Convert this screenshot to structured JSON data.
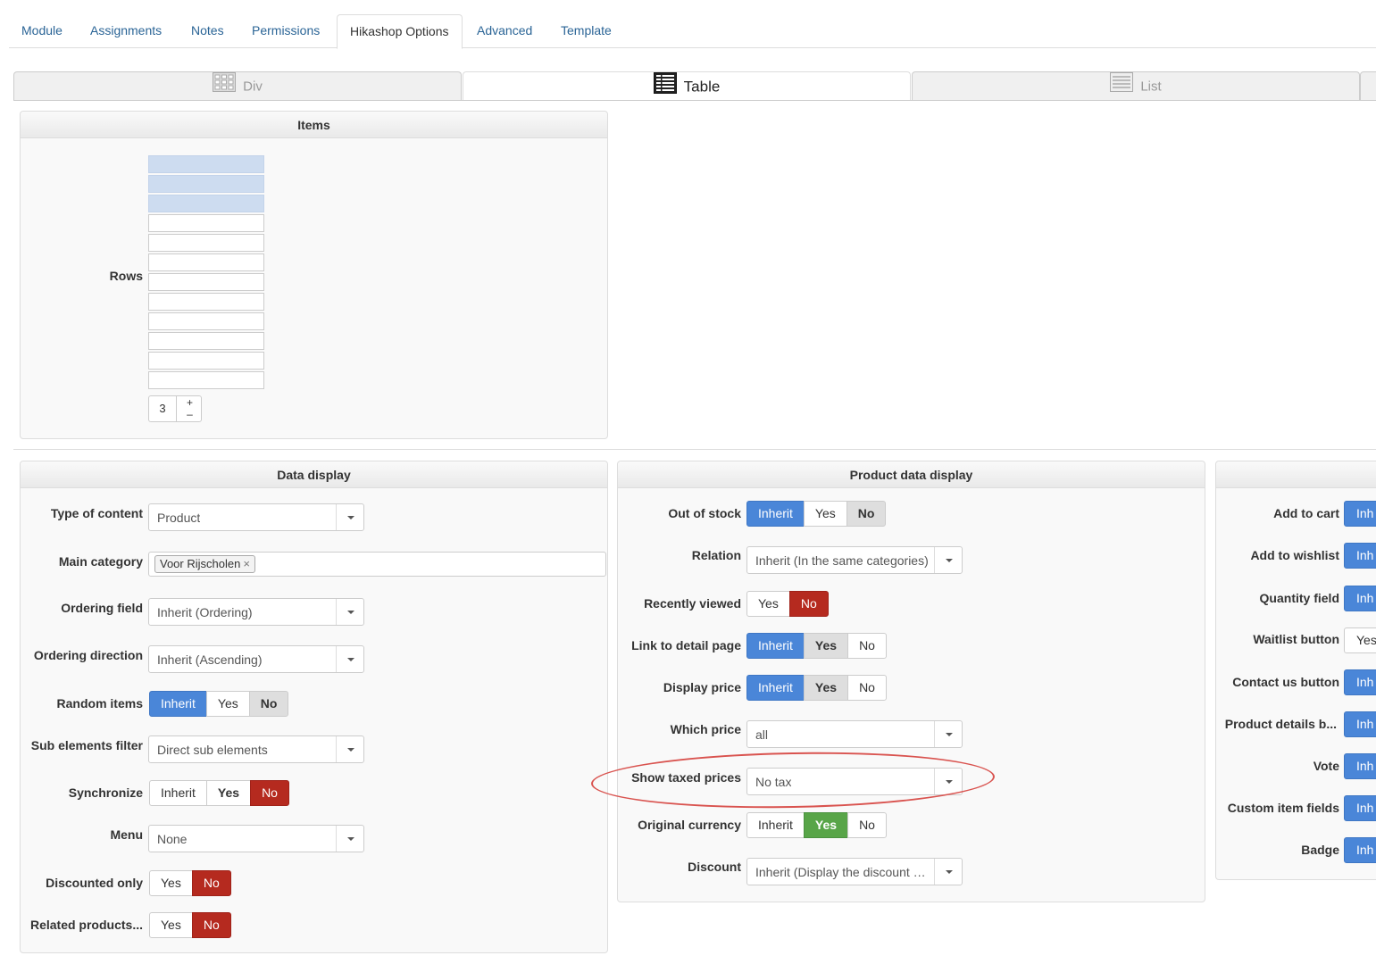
{
  "nav_tabs": [
    "Module",
    "Assignments",
    "Notes",
    "Permissions",
    "Hikashop Options",
    "Advanced",
    "Template"
  ],
  "layout_tabs": [
    "Div",
    "Table",
    "List"
  ],
  "items_panel": {
    "title": "Items",
    "rows_label": "Rows",
    "rows_value": "3",
    "plus": "+",
    "minus": "–"
  },
  "data_display": {
    "title": "Data display",
    "type_of_content": {
      "label": "Type of content",
      "value": "Product"
    },
    "main_category": {
      "label": "Main category",
      "tag": "Voor Rijscholen",
      "remove": "×"
    },
    "ordering_field": {
      "label": "Ordering field",
      "value": "Inherit (Ordering)"
    },
    "ordering_direction": {
      "label": "Ordering direction",
      "value": "Inherit (Ascending)"
    },
    "random_items": {
      "label": "Random items",
      "options": [
        "Inherit",
        "Yes",
        "No"
      ]
    },
    "sub_elements_filter": {
      "label": "Sub elements filter",
      "value": "Direct sub elements"
    },
    "synchronize": {
      "label": "Synchronize",
      "options": [
        "Inherit",
        "Yes",
        "No"
      ]
    },
    "menu": {
      "label": "Menu",
      "value": "None"
    },
    "discounted_only": {
      "label": "Discounted only",
      "options": [
        "Yes",
        "No"
      ]
    },
    "related_products": {
      "label": "Related products...",
      "options": [
        "Yes",
        "No"
      ]
    }
  },
  "product_data_display": {
    "title": "Product data display",
    "out_of_stock": {
      "label": "Out of stock",
      "options": [
        "Inherit",
        "Yes",
        "No"
      ]
    },
    "relation": {
      "label": "Relation",
      "value": "Inherit (In the same categories)"
    },
    "recently_viewed": {
      "label": "Recently viewed",
      "options": [
        "Yes",
        "No"
      ]
    },
    "link_to_detail": {
      "label": "Link to detail page",
      "options": [
        "Inherit",
        "Yes",
        "No"
      ]
    },
    "display_price": {
      "label": "Display price",
      "options": [
        "Inherit",
        "Yes",
        "No"
      ]
    },
    "which_price": {
      "label": "Which price",
      "value": "all"
    },
    "show_taxed": {
      "label": "Show taxed prices",
      "value": "No tax"
    },
    "original_currency": {
      "label": "Original currency",
      "options": [
        "Inherit",
        "Yes",
        "No"
      ]
    },
    "discount": {
      "label": "Discount",
      "value": "Inherit (Display the discount …"
    }
  },
  "right_panel": {
    "labels": [
      "Add to cart",
      "Add to wishlist",
      "Quantity field",
      "Waitlist button",
      "Contact us button",
      "Product details b...",
      "Vote",
      "Custom item fields",
      "Badge"
    ],
    "first_buttons": [
      "Inh",
      "Inh",
      "Inh",
      "Yes",
      "Inh",
      "Inh",
      "Inh",
      "Inh",
      "Inh"
    ]
  },
  "colors": {
    "blue": "#4a86d8",
    "red": "#b52a1f",
    "green": "#58a548",
    "highlight": "#d9534f"
  }
}
